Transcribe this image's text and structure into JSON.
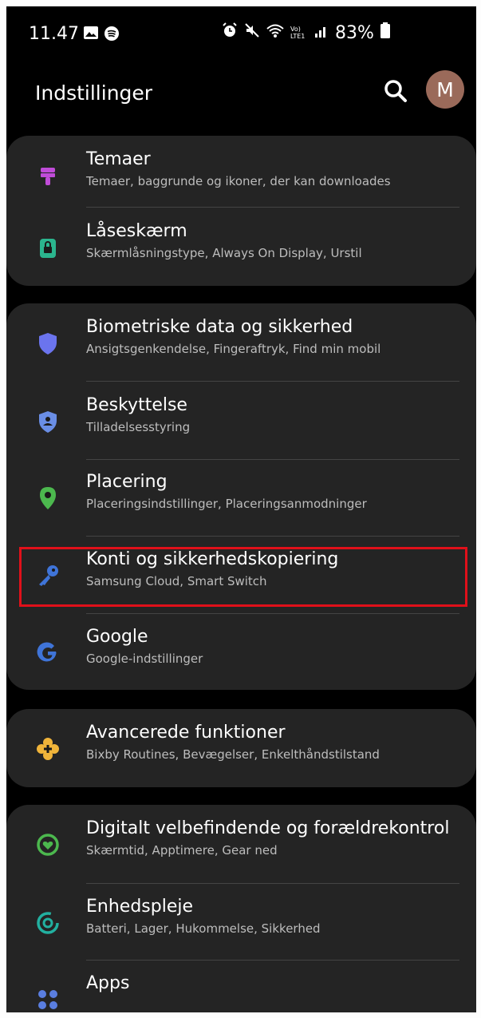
{
  "status_bar": {
    "time": "11.47",
    "battery": "83%",
    "network": "Vo) LTE1"
  },
  "header": {
    "title": "Indstillinger",
    "avatar_initial": "M"
  },
  "colors": {
    "background": "#000000",
    "card": "#242424",
    "highlight_border": "#e0101a",
    "avatar": "#9a6a5a"
  },
  "groups": [
    {
      "items": [
        {
          "title": "Temaer",
          "subtitle": "Temaer, baggrunde og ikoner, der kan downloades",
          "icon": "theme-brush-icon"
        },
        {
          "title": "Låseskærm",
          "subtitle": "Skærmlåsningstype, Always On Display, Urstil",
          "icon": "lock-screen-icon"
        }
      ]
    },
    {
      "items": [
        {
          "title": "Biometriske data og sikkerhed",
          "subtitle": "Ansigtsgenkendelse, Fingeraftryk, Find min mobil",
          "icon": "shield-icon"
        },
        {
          "title": "Beskyttelse",
          "subtitle": "Tilladelsesstyring",
          "icon": "privacy-shield-icon"
        },
        {
          "title": "Placering",
          "subtitle": "Placeringsindstillinger, Placeringsanmodninger",
          "icon": "location-pin-icon"
        },
        {
          "title": "Konti og sikkerhedskopiering",
          "subtitle": "Samsung Cloud, Smart Switch",
          "icon": "key-icon"
        },
        {
          "title": "Google",
          "subtitle": "Google-indstillinger",
          "icon": "google-g-icon"
        }
      ]
    },
    {
      "items": [
        {
          "title": "Avancerede funktioner",
          "subtitle": "Bixby Routines, Bevægelser, Enkelthåndstilstand",
          "icon": "advanced-gear-plus-icon"
        }
      ]
    },
    {
      "items": [
        {
          "title": "Digitalt velbefindende og forældrekontrol",
          "subtitle": "Skærmtid, Apptimere, Gear ned",
          "icon": "wellbeing-heart-icon"
        },
        {
          "title": "Enhedspleje",
          "subtitle": "Batteri, Lager, Hukommelse, Sikkerhed",
          "icon": "device-care-icon"
        },
        {
          "title": "Apps",
          "subtitle": "",
          "icon": "apps-grid-icon"
        }
      ]
    }
  ]
}
